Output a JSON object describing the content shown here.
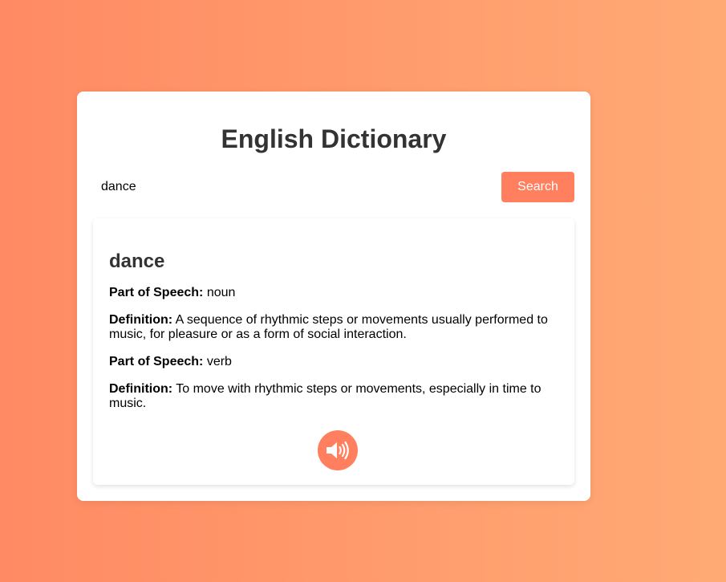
{
  "app": {
    "title": "English Dictionary"
  },
  "search": {
    "value": "dance",
    "button_label": "Search"
  },
  "result": {
    "word": "dance",
    "entries": [
      {
        "pos_label": "Part of Speech:",
        "pos_value": "noun",
        "def_label": "Definition:",
        "def_value": "A sequence of rhythmic steps or movements usually performed to music, for pleasure or as a form of social interaction."
      },
      {
        "pos_label": "Part of Speech:",
        "pos_value": "verb",
        "def_label": "Definition:",
        "def_value": "To move with rhythmic steps or movements, especially in time to music."
      }
    ],
    "audio_icon": "speaker-icon"
  },
  "colors": {
    "accent": "#ff7f5e",
    "background_start": "#ff8a63",
    "background_end": "#ffaa75",
    "title_text": "#333333"
  }
}
